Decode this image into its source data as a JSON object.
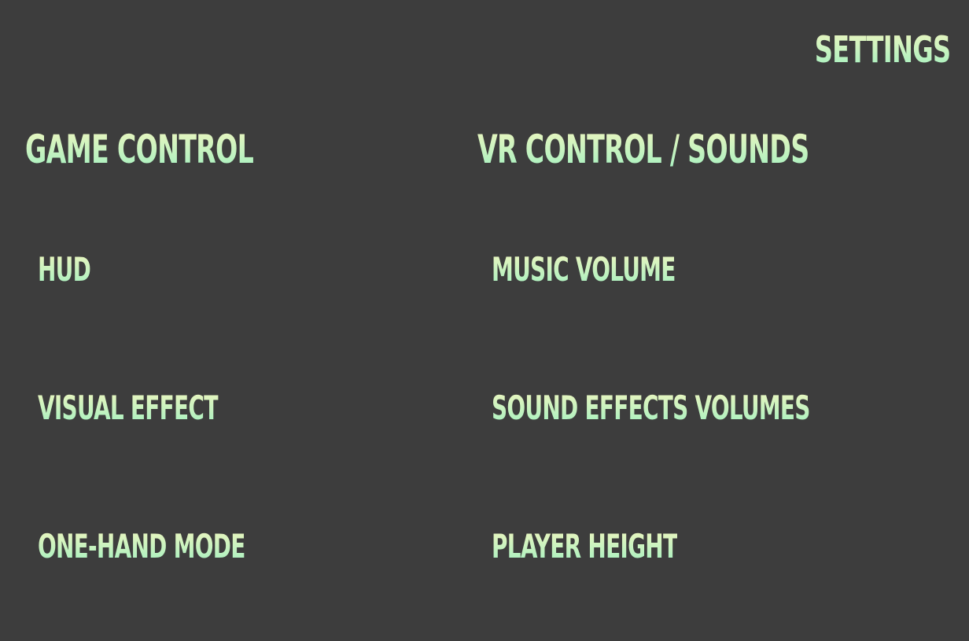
{
  "screen": {
    "title": "SETTINGS",
    "background_color": "#3d3d3d",
    "text_gradient": [
      "#f2f6bf",
      "#9ff0c0"
    ]
  },
  "game_control": {
    "heading": "GAME CONTROL",
    "items": [
      {
        "label": "HUD"
      },
      {
        "label": "VISUAL EFFECT"
      },
      {
        "label": "ONE-HAND MODE"
      }
    ]
  },
  "vr_control_sounds": {
    "heading": "VR CONTROL / SOUNDS",
    "items": [
      {
        "label": "MUSIC VOLUME"
      },
      {
        "label": "SOUND EFFECTS VOLUMES"
      },
      {
        "label": "PLAYER HEIGHT"
      }
    ]
  }
}
